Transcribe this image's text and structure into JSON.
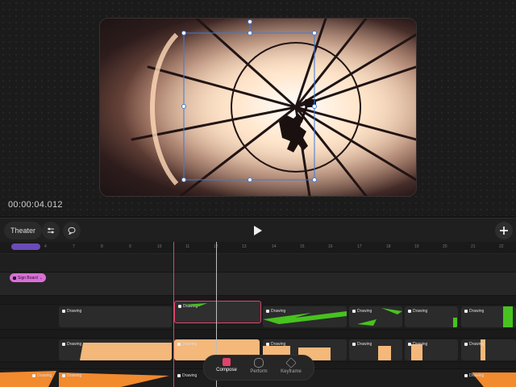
{
  "viewer": {
    "timecode": "00:00:04.012"
  },
  "toolbar": {
    "theater_label": "Theater",
    "icons": [
      "sliders-icon",
      "comment-icon",
      "play-icon",
      "plus-icon"
    ]
  },
  "ruler": {
    "ticks": [
      "4",
      "7",
      "8",
      "9",
      "10",
      "11",
      "12",
      "13",
      "14",
      "15",
      "16",
      "17",
      "18",
      "19",
      "20",
      "21",
      "22"
    ]
  },
  "tracks": {
    "tag_label": "Sign Board",
    "clip_label": "Drawing"
  },
  "modes": {
    "items": [
      {
        "label": "Compose",
        "active": true
      },
      {
        "label": "Perform",
        "active": false
      },
      {
        "label": "Keyframe",
        "active": false
      }
    ]
  },
  "colors": {
    "accent": "#e0436b",
    "tag": "#d86fd6",
    "selection": "#3f7bd8",
    "green": "#48c21f",
    "orange": "#f28a2e"
  }
}
